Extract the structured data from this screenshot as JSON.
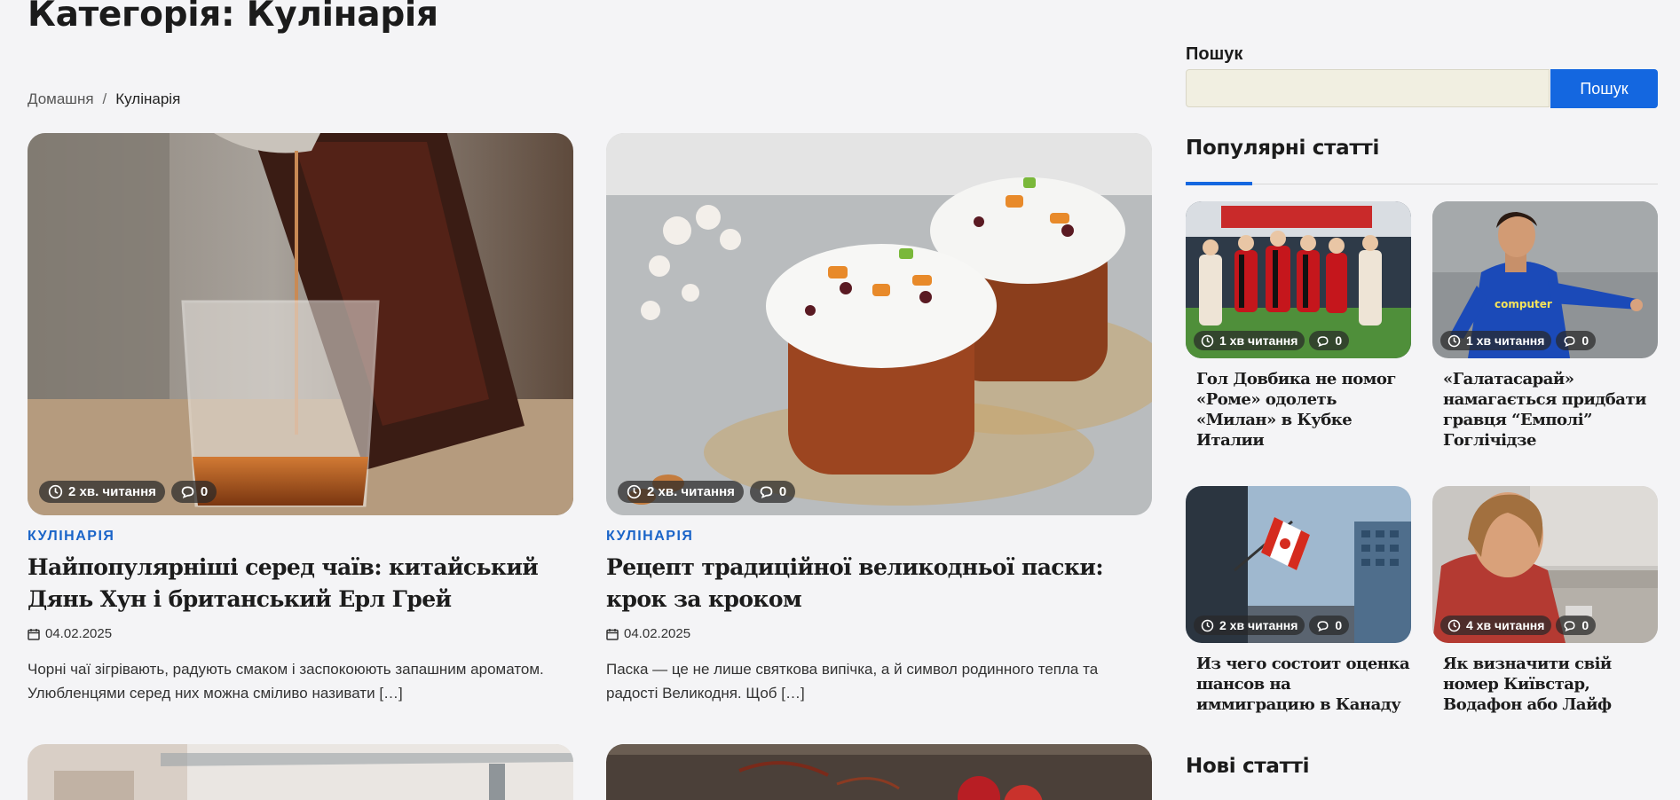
{
  "page": {
    "title": "Категорія: Кулінарія"
  },
  "breadcrumb": {
    "home": "Домашня",
    "separator": "/",
    "current": "Кулінарія"
  },
  "posts": [
    {
      "category": "КУЛІНАРІЯ",
      "title": "Найпопулярніші серед чаїв: китайський Дянь Хун і британський Ерл Грей",
      "date": "04.02.2025",
      "read_time": "2 хв. читання",
      "comments": "0",
      "excerpt": "Чорні чаї зігрівають, радують смаком і заспокоюють запашним ароматом. Улюбленцями серед них можна сміливо називати […]"
    },
    {
      "category": "КУЛІНАРІЯ",
      "title": "Рецепт традиційної великодньої паски: крок за кроком",
      "date": "04.02.2025",
      "read_time": "2 хв. читання",
      "comments": "0",
      "excerpt": "Паска — це не лише святкова випічка, а й символ родинного тепла та радості Великодня. Щоб […]"
    }
  ],
  "sidebar": {
    "search_label": "Пошук",
    "search_placeholder": "",
    "search_button": "Пошук",
    "popular_title": "Популярні статті",
    "new_title": "Нові статті",
    "popular": [
      {
        "title": "Гол Довбика не помог «Роме» одолеть «Милан» в Кубке Италии",
        "read_time": "1 хв читання",
        "comments": "0"
      },
      {
        "title": "«Галатасарай» намагається придбати гравця “Емполі” Гоглічідзе",
        "read_time": "1 хв читання",
        "comments": "0"
      },
      {
        "title": "Из чего состоит оценка шансов на иммиграцию в Канаду",
        "read_time": "2 хв читання",
        "comments": "0"
      },
      {
        "title": "Як визначити свій номер Київстар, Водафон або Лайф",
        "read_time": "4 хв читання",
        "comments": "0"
      }
    ]
  },
  "colors": {
    "accent": "#1467e0",
    "category": "#1a64c8",
    "background": "#f4f4f6"
  },
  "icons": [
    "clock-icon",
    "comment-icon",
    "calendar-icon"
  ]
}
